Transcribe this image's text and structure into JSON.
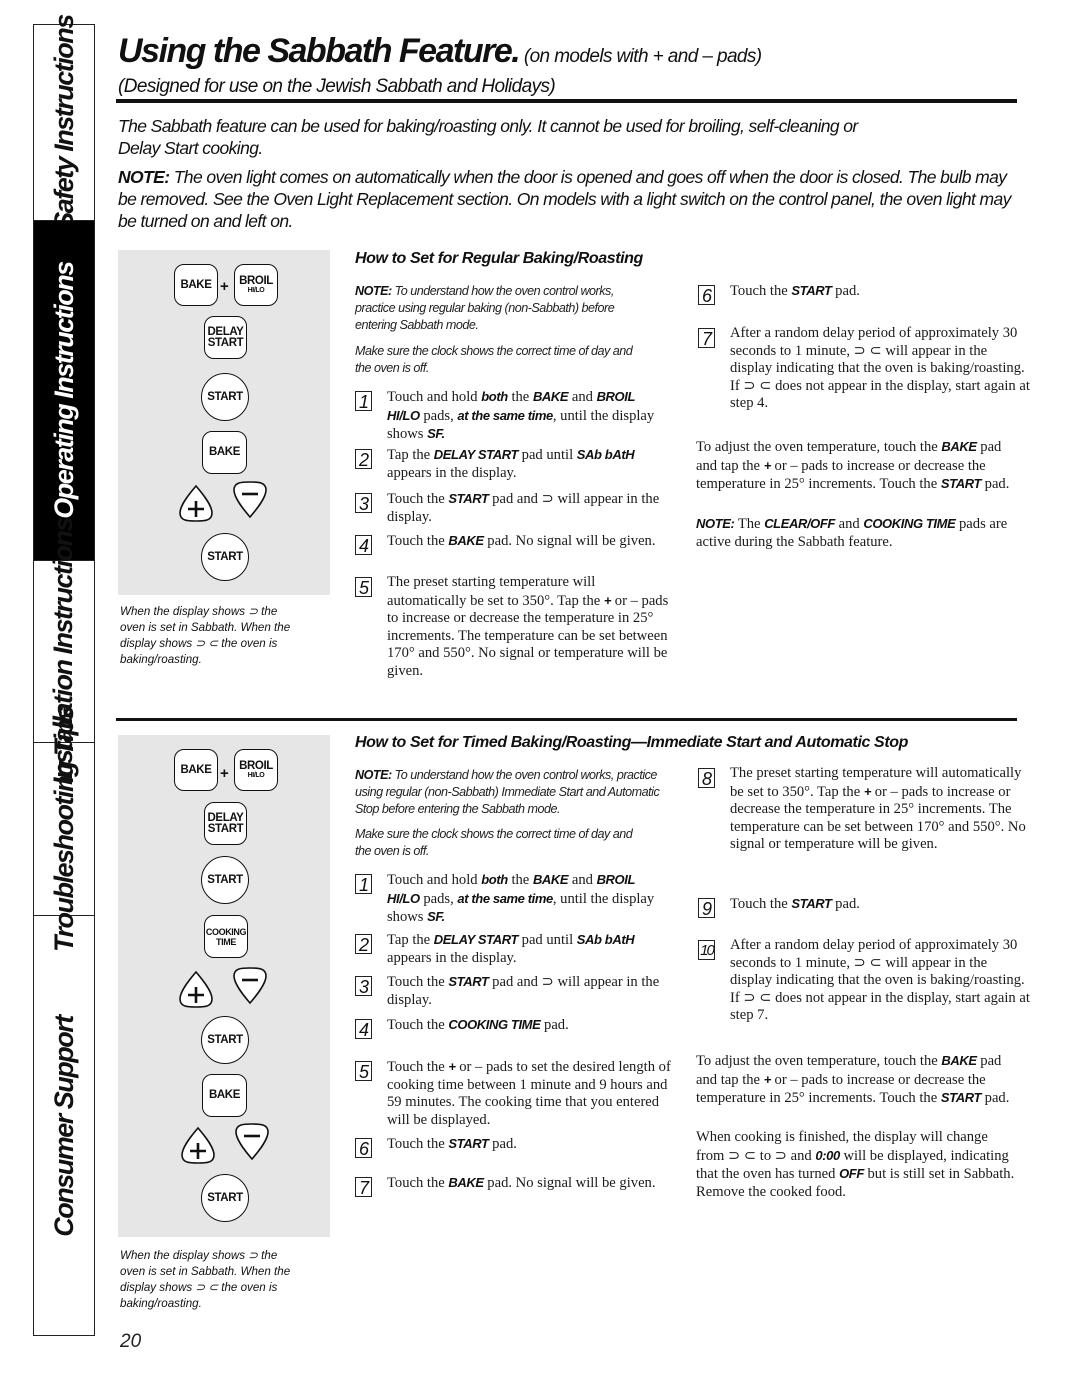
{
  "side_tabs": [
    {
      "label": "Safety Instructions",
      "active": false
    },
    {
      "label": "Operating Instructions",
      "active": true
    },
    {
      "label": "Installation Instructions",
      "active": false
    },
    {
      "label": "Troubleshooting Tips",
      "active": false
    },
    {
      "label": "Consumer Support",
      "active": false
    }
  ],
  "header": {
    "title": "Using the Sabbath Feature.",
    "title_suffix": " (on models with + and – pads)",
    "subtitle": "(Designed for use on the Jewish Sabbath and Holidays)"
  },
  "intro": {
    "paragraph": "The Sabbath feature can be used for baking/roasting only. It cannot be used for broiling, self-cleaning or Delay Start cooking.",
    "note_label": "NOTE:",
    "note_text": " The oven light comes on automatically when the door is opened and goes off when the door is closed. The bulb may be removed. See the Oven Light Replacement section. On models with a light switch on the control panel, the oven light may be turned on and left on."
  },
  "pads": {
    "bake": "BAKE",
    "broil": "BROIL",
    "hilo": "HI/LO",
    "plus_join": "+",
    "delay": "DELAY",
    "start_word": "START",
    "start": "START",
    "cooking": "COOKING",
    "time": "TIME"
  },
  "caption": {
    "line1": "When the display shows ⊃ the",
    "line2": "oven is set in Sabbath. When the",
    "line3": "display shows ⊃ ⊂  the oven is",
    "line4": "baking/roasting."
  },
  "regular": {
    "heading": "How to Set for Regular Baking/Roasting",
    "note_label": "NOTE:",
    "note_text": " To understand how the oven control works, practice using regular baking (non-Sabbath) before entering Sabbath mode.",
    "clock_note": "Make sure the clock shows the correct time of day and the oven is off.",
    "steps": [
      {
        "n": "1",
        "parts": [
          "Touch and hold ",
          "both",
          " the ",
          "BAKE",
          " and ",
          "BROIL HI/LO",
          " pads, ",
          "at the same time",
          ", until the display shows ",
          "SF."
        ]
      },
      {
        "n": "2",
        "parts": [
          "Tap the ",
          "DELAY START",
          " pad until ",
          "SAb bAtH",
          " appears in the display."
        ]
      },
      {
        "n": "3",
        "parts": [
          "Touch the ",
          "START",
          " pad and ⊃ will appear in the display."
        ]
      },
      {
        "n": "4",
        "parts": [
          "Touch the ",
          "BAKE",
          " pad. No signal will be given."
        ]
      },
      {
        "n": "5",
        "parts": [
          "The preset starting temperature will automatically be set to 350°. Tap the ",
          "+",
          " or – pads to increase or decrease the temperature in 25° increments. The temperature can be set between 170° and 550°. No signal or temperature will be given."
        ]
      },
      {
        "n": "6",
        "parts": [
          "Touch the ",
          "START",
          " pad."
        ]
      },
      {
        "n": "7",
        "parts": [
          "After a random delay period of approximately 30 seconds to 1 minute, ⊃ ⊂ will appear in the display indicating that the oven is baking/roasting. If ⊃ ⊂ does not appear in the display, start again at step 4."
        ]
      }
    ],
    "adjust": [
      "To adjust the oven temperature, touch the ",
      "BAKE",
      " pad and tap the ",
      "+",
      " or – pads to increase or decrease the temperature in 25° increments. Touch the ",
      "START",
      " pad."
    ],
    "active_note": [
      "NOTE:",
      " The ",
      "CLEAR/OFF",
      " and ",
      "COOKING TIME",
      " pads are active during the Sabbath feature."
    ]
  },
  "timed": {
    "heading": "How to Set for Timed Baking/Roasting—Immediate Start and Automatic Stop",
    "note_label": "NOTE:",
    "note_text": " To understand how the oven control works, practice using regular (non-Sabbath) Immediate Start and Automatic Stop before entering the Sabbath mode.",
    "clock_note": "Make sure the clock shows the correct time of day and the oven is off.",
    "steps": [
      {
        "n": "1",
        "parts": [
          "Touch and hold ",
          "both",
          " the ",
          "BAKE",
          " and ",
          "BROIL HI/LO",
          " pads, ",
          "at the same time",
          ", until the display shows ",
          "SF."
        ]
      },
      {
        "n": "2",
        "parts": [
          "Tap the ",
          "DELAY START",
          " pad until ",
          "SAb bAtH",
          " appears in the display."
        ]
      },
      {
        "n": "3",
        "parts": [
          "Touch the ",
          "START",
          " pad and ⊃ will appear in the display."
        ]
      },
      {
        "n": "4",
        "parts": [
          "Touch the ",
          "COOKING TIME",
          " pad."
        ]
      },
      {
        "n": "5",
        "parts": [
          "Touch the ",
          "+",
          " or – pads to set the desired length of cooking time between 1 minute and 9 hours and 59 minutes. The cooking time that you entered will be displayed."
        ]
      },
      {
        "n": "6",
        "parts": [
          "Touch the ",
          "START",
          " pad."
        ]
      },
      {
        "n": "7",
        "parts": [
          "Touch the ",
          "BAKE",
          " pad. No signal will be given."
        ]
      },
      {
        "n": "8",
        "parts": [
          "The preset starting temperature will automatically be set to 350°. Tap the ",
          "+",
          " or – pads to increase or decrease the temperature in 25° increments. The temperature can be set between 170° and 550°. No signal or temperature will be given."
        ]
      },
      {
        "n": "9",
        "parts": [
          "Touch the ",
          "START",
          " pad."
        ]
      },
      {
        "n": "10",
        "parts": [
          "After a random delay period of approximately 30 seconds to 1 minute, ⊃ ⊂ will appear in the display indicating that the oven is baking/roasting. If ⊃ ⊂ does not appear in the display, start again at step 7."
        ]
      }
    ],
    "adjust": [
      "To adjust the oven temperature, touch the ",
      "BAKE",
      " pad and tap the ",
      "+",
      " or – pads to increase or decrease the temperature in 25° increments. Touch the ",
      "START",
      " pad."
    ],
    "finish": [
      "When cooking is finished, the display will change from ⊃ ⊂ to ⊃ and ",
      "0:00",
      " will be displayed, indicating that the oven has turned ",
      "OFF",
      " but is still set in Sabbath. Remove the cooked food."
    ]
  },
  "page_number": "20"
}
